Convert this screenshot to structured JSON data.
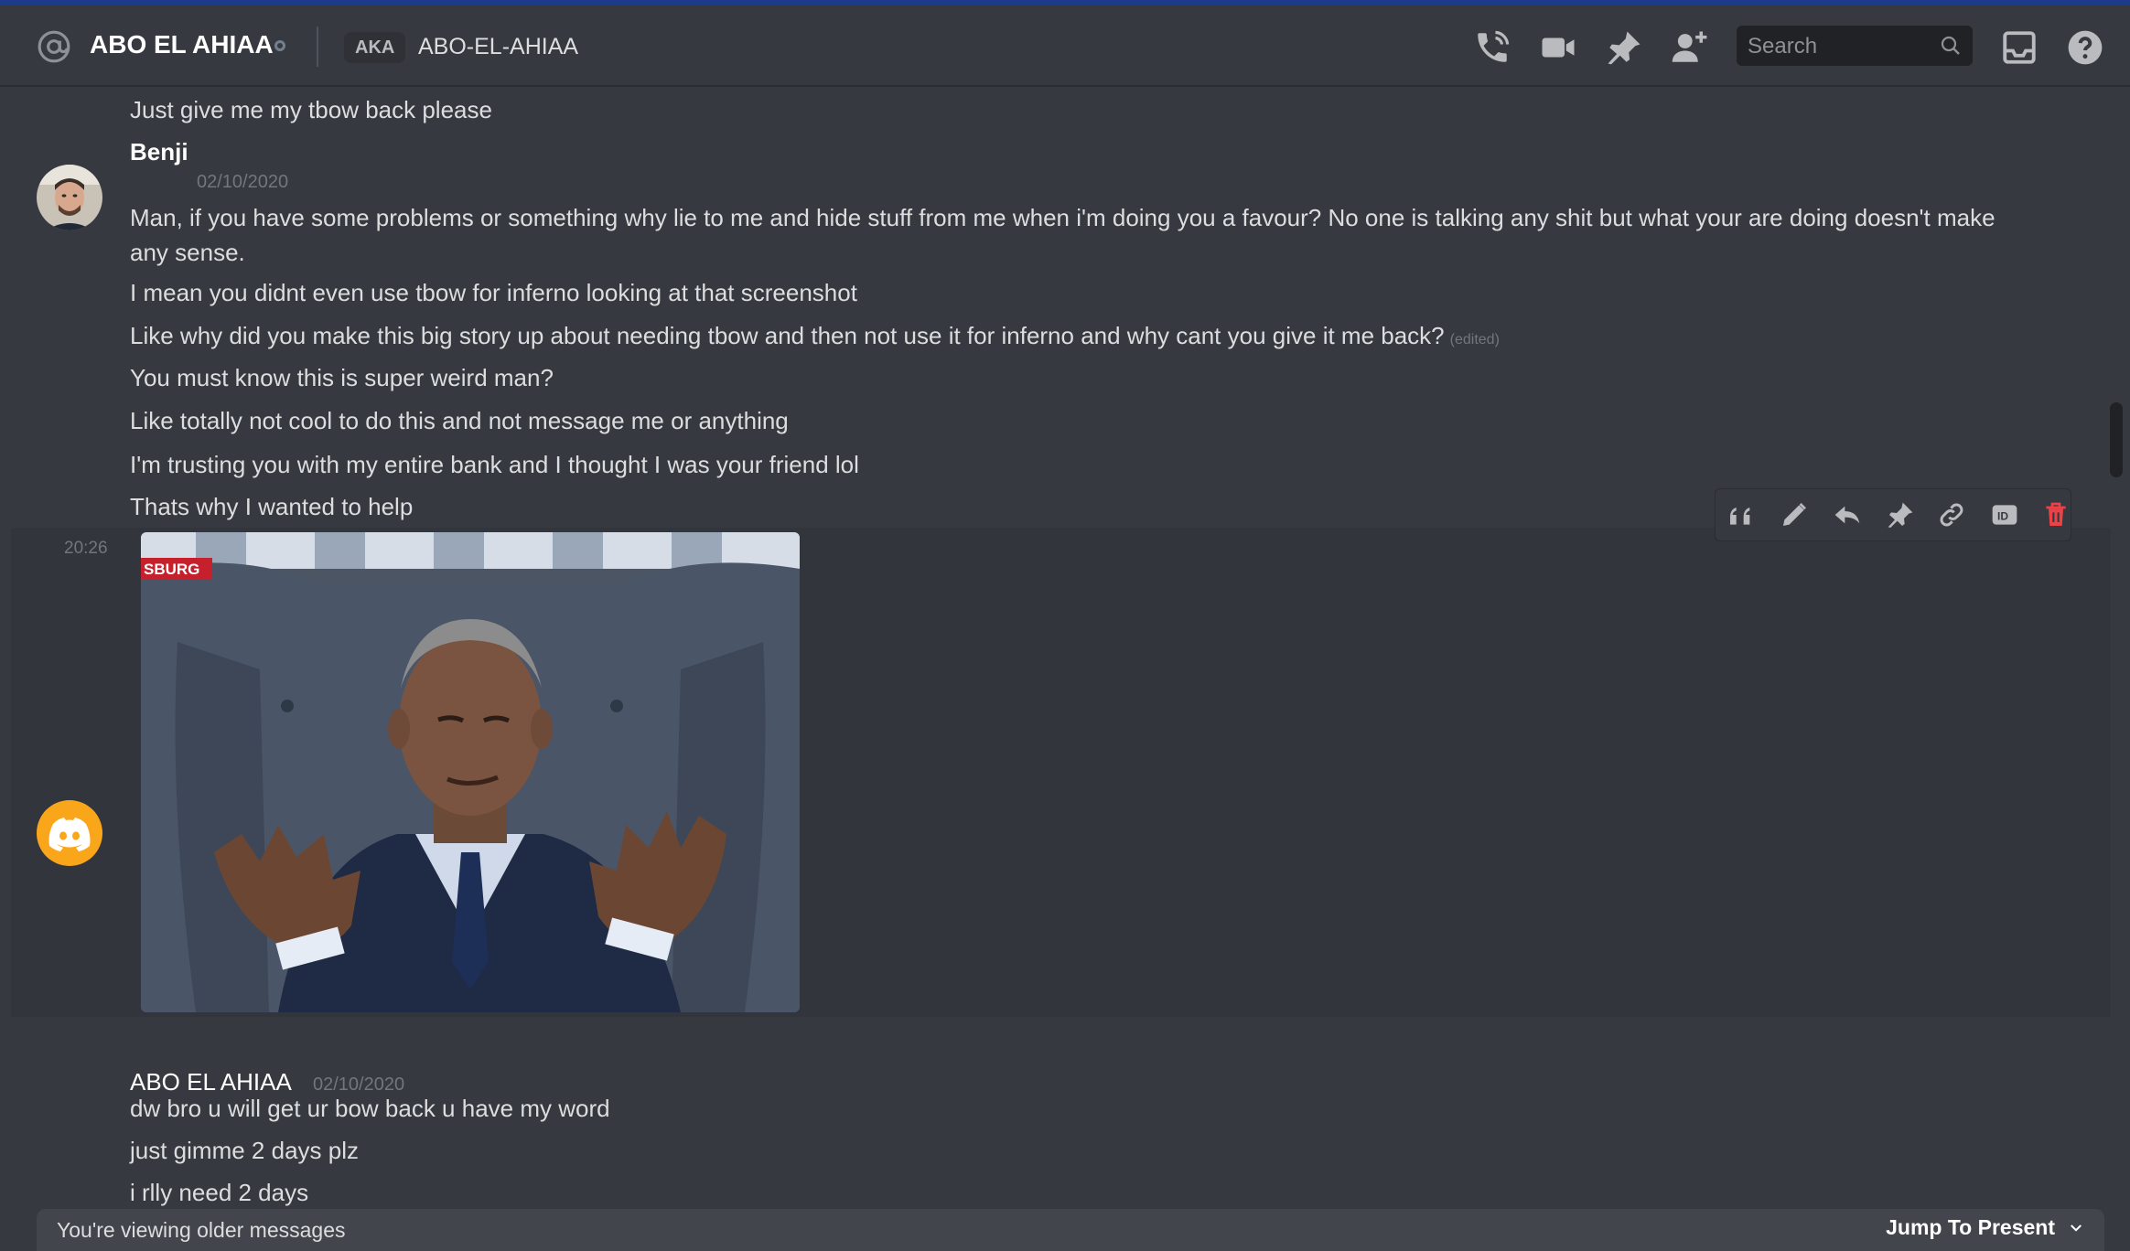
{
  "header": {
    "title": "ABO EL AHIAA",
    "aka_badge": "AKA",
    "aka_name": "ABO-EL-AHIAA",
    "search_placeholder": "Search",
    "icons": [
      "at-icon",
      "voice-call-icon",
      "video-call-icon",
      "pin-icon",
      "add-friend-icon",
      "search-icon",
      "inbox-icon",
      "help-icon"
    ]
  },
  "messages": {
    "top_line": "Just give me my tbow back please",
    "benji": {
      "author": "Benji",
      "date": "02/10/2020",
      "lines": [
        "Man, if you have some problems or something why lie to me and hide stuff from me when i'm doing you a favour? No one is talking any shit but what your are doing doesn't make any sense.",
        "I mean you didnt even use tbow for inferno looking at that screenshot",
        "Like why did you make this big story up about needing tbow and then not use it for inferno and why cant you give it me back?",
        "You must know this is super weird man?",
        "Like totally not cool to do this and not message me or anything",
        "I'm trusting you with my entire bank and I thought I was your friend lol",
        "Thats why I wanted to help"
      ],
      "edited": "(edited)",
      "gif_time": "20:26",
      "gif_label": "SBURG"
    },
    "abo": {
      "author": "ABO EL AHIAA",
      "date": "02/10/2020",
      "lines": [
        "dw bro u will get ur bow back u have my word",
        "just gimme 2 days plz",
        "i rlly need 2 days"
      ]
    }
  },
  "action_bar": {
    "icons": [
      "quote-icon",
      "edit-icon",
      "reply-icon",
      "pin-icon",
      "link-icon",
      "id-icon",
      "delete-icon"
    ]
  },
  "footer": {
    "older_text": "You're viewing older messages",
    "jump_label": "Jump To Present"
  },
  "colors": {
    "background": "#36393f",
    "header_text": "#ffffff",
    "timestamp": "#72767d",
    "delete_red": "#ed4245",
    "discord_orange": "#faa61a"
  }
}
